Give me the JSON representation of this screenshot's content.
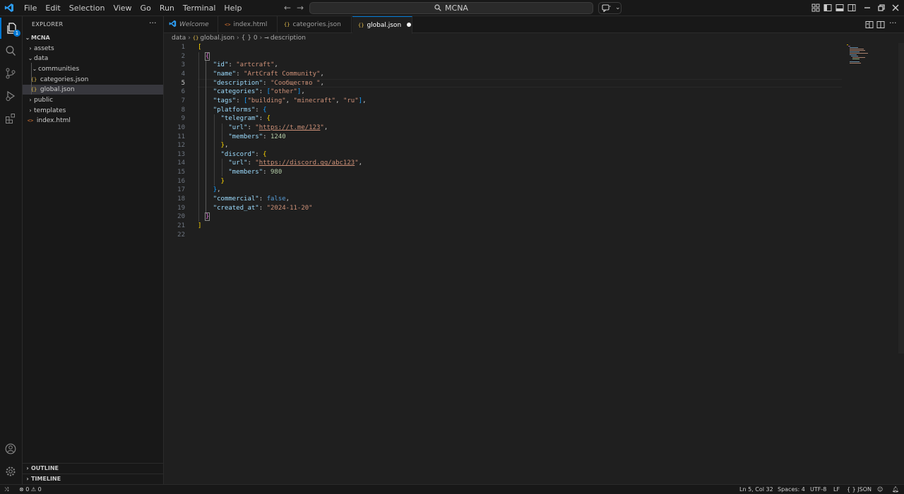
{
  "menu": [
    "File",
    "Edit",
    "Selection",
    "View",
    "Go",
    "Run",
    "Terminal",
    "Help"
  ],
  "search": {
    "text": "MCNA"
  },
  "activity": {
    "explorer_badge": "1"
  },
  "sidebar": {
    "title": "EXPLORER",
    "more": "···",
    "root": "MCNA",
    "items": [
      {
        "label": "assets",
        "kind": "folder",
        "open": false
      },
      {
        "label": "data",
        "kind": "folder",
        "open": true
      },
      {
        "label": "communities",
        "kind": "folder",
        "open": true
      },
      {
        "label": "categories.json",
        "kind": "json"
      },
      {
        "label": "global.json",
        "kind": "json",
        "selected": true
      },
      {
        "label": "public",
        "kind": "folder",
        "open": false
      },
      {
        "label": "templates",
        "kind": "folder",
        "open": false
      },
      {
        "label": "index.html",
        "kind": "html"
      }
    ],
    "outline": "OUTLINE",
    "timeline": "TIMELINE"
  },
  "tabs": [
    {
      "label": "Welcome",
      "icon": "vscode-logo-icon"
    },
    {
      "label": "index.html",
      "icon": "html-file-icon"
    },
    {
      "label": "categories.json",
      "icon": "json-file-icon"
    },
    {
      "label": "global.json",
      "icon": "json-file-icon",
      "active": true,
      "dirty": true
    }
  ],
  "breadcrumb": {
    "folder": "data",
    "file": "global.json",
    "index": "{ } 0",
    "key": "description"
  },
  "editor": {
    "line_numbers": [
      "1",
      "2",
      "3",
      "4",
      "5",
      "6",
      "7",
      "8",
      "9",
      "10",
      "11",
      "12",
      "13",
      "14",
      "15",
      "16",
      "17",
      "18",
      "19",
      "20",
      "21",
      "22"
    ],
    "current_line": "5",
    "values": {
      "id_key": "\"id\"",
      "id_val": "\"artcraft\"",
      "name_key": "\"name\"",
      "name_val": "\"ArtCraft Community\"",
      "desc_key": "\"description\"",
      "desc_val": "\"Сообщество \"",
      "cat_key": "\"categories\"",
      "cat_val": "\"other\"",
      "tags_key": "\"tags\"",
      "tag1": "\"building\"",
      "tag2": "\"minecraft\"",
      "tag3": "\"ru\"",
      "platforms_key": "\"platforms\"",
      "telegram_key": "\"telegram\"",
      "url_key": "\"url\"",
      "tg_url_open": "\"",
      "tg_url": "https://t.me/123",
      "tg_url_close": "\"",
      "members_key": "\"members\"",
      "tg_members": "1240",
      "discord_key": "\"discord\"",
      "dc_url_open": "\"",
      "dc_url": "https://discord.gg/abc123",
      "dc_url_close": "\"",
      "dc_members": "980",
      "commercial_key": "\"commercial\"",
      "commercial_val": "false",
      "created_key": "\"created_at\"",
      "created_val": "\"2024-11-20\""
    }
  },
  "status": {
    "errors": "0",
    "warnings": "0",
    "position": "Ln 5, Col 32",
    "spaces": "Spaces: 4",
    "encoding": "UTF-8",
    "eol": "LF",
    "lang_icon": "{ }",
    "language": "JSON"
  },
  "colors": {
    "accent": "#0078d4",
    "json_icon": "#e8c14e",
    "html_icon": "#e37933"
  }
}
